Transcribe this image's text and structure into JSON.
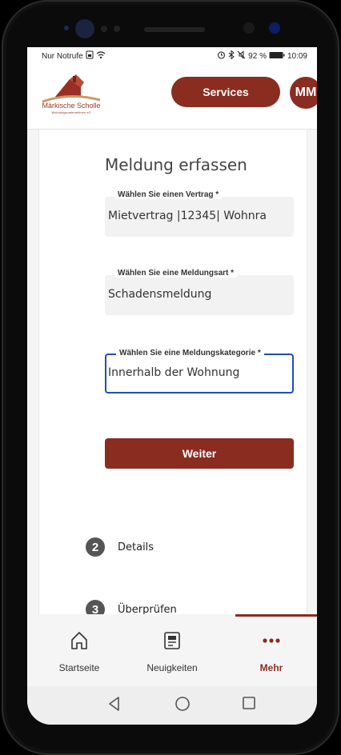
{
  "status_bar": {
    "carrier": "Nur Notrufe",
    "battery": "92 %",
    "time": "10:09"
  },
  "header": {
    "logo_name": "Märkische Scholle",
    "logo_subtitle": "Wohnungsunternehmen eG",
    "services_label": "Services",
    "avatar_initials": "MM"
  },
  "form": {
    "title": "Meldung erfassen",
    "fields": [
      {
        "label": "Wählen Sie einen Vertrag *",
        "value": "Mietvertrag |12345| Wohnra"
      },
      {
        "label": "Wählen Sie eine Meldungsart *",
        "value": "Schadensmeldung"
      },
      {
        "label": "Wählen Sie eine Meldungskategorie *",
        "value": "Innerhalb der Wohnung"
      }
    ],
    "next_label": "Weiter"
  },
  "steps": [
    {
      "number": "2",
      "label": "Details"
    },
    {
      "number": "3",
      "label": "Überprüfen"
    }
  ],
  "bottom_nav": [
    {
      "label": "Startseite",
      "icon": "home-icon"
    },
    {
      "label": "Neuigkeiten",
      "icon": "news-icon"
    },
    {
      "label": "Mehr",
      "icon": "more-icon",
      "active": true
    }
  ],
  "colors": {
    "brand": "#8a2c20",
    "focus": "#1f4fb5"
  }
}
